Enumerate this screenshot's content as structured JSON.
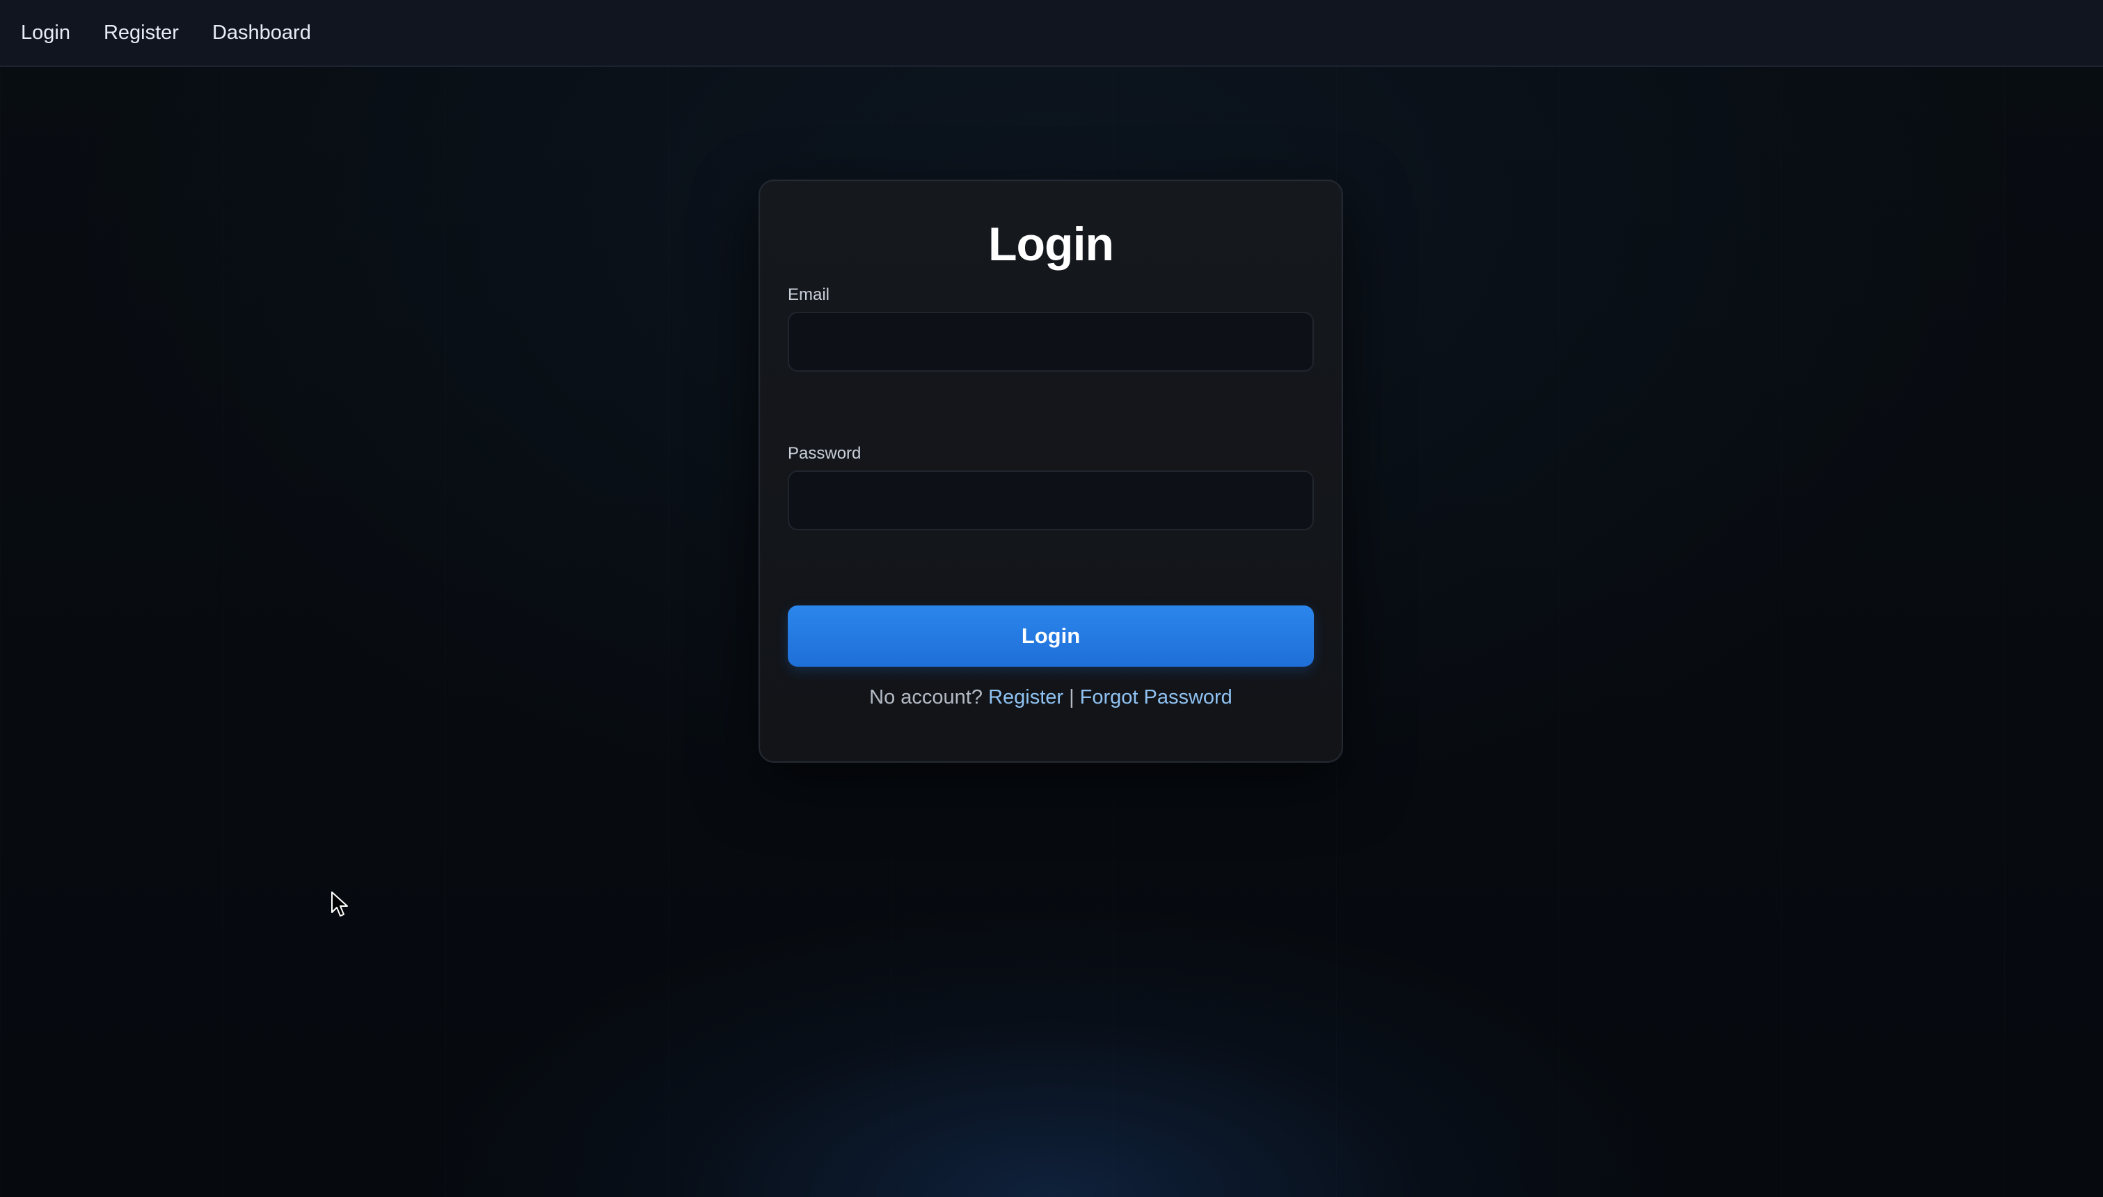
{
  "nav": {
    "links": [
      {
        "label": "Login"
      },
      {
        "label": "Register"
      },
      {
        "label": "Dashboard"
      }
    ]
  },
  "card": {
    "title": "Login",
    "email": {
      "label": "Email",
      "value": "",
      "placeholder": ""
    },
    "password": {
      "label": "Password",
      "value": "",
      "placeholder": ""
    },
    "submit_label": "Login",
    "footer": {
      "prompt": "No account?",
      "register_link": "Register",
      "separator": "|",
      "forgot_link": "Forgot Password"
    }
  },
  "colors": {
    "accent": "#2b86ec",
    "link": "#8fc2f2",
    "background": "#060a0e"
  },
  "icons": {
    "cursor": "mouse-pointer-icon"
  }
}
